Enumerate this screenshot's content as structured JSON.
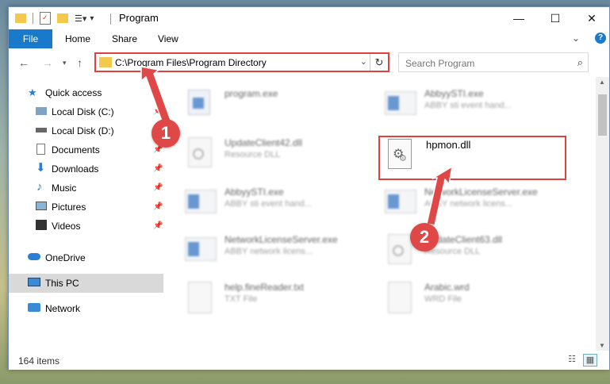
{
  "window": {
    "title": "Program"
  },
  "ribbon": {
    "tabs": [
      {
        "label": "File"
      },
      {
        "label": "Home"
      },
      {
        "label": "Share"
      },
      {
        "label": "View"
      }
    ],
    "expand_icon": "chevron-down-icon",
    "help_label": "?"
  },
  "nav": {
    "address": "C:\\Program Files\\Program Directory",
    "search_placeholder": "Search Program"
  },
  "sidebar": {
    "items": [
      {
        "label": "Quick access"
      },
      {
        "label": "Local Disk (C:)"
      },
      {
        "label": "Local Disk (D:)"
      },
      {
        "label": "Documents"
      },
      {
        "label": "Downloads"
      },
      {
        "label": "Music"
      },
      {
        "label": "Pictures"
      },
      {
        "label": "Videos"
      },
      {
        "label": "OneDrive"
      },
      {
        "label": "This PC"
      },
      {
        "label": "Network"
      }
    ]
  },
  "files": [
    {
      "name": "program.exe",
      "desc": ""
    },
    {
      "name": "AbbyySTI.exe",
      "desc": "ABBY sti event hand..."
    },
    {
      "name": "UpdateClient42.dll",
      "desc": "Resource DLL"
    },
    {
      "name": "hpmon.dll",
      "desc": ""
    },
    {
      "name": "AbbyySTI.exe",
      "desc": "ABBY sti event hand..."
    },
    {
      "name": "NetworkLicenseServer.exe",
      "desc": "ABBY network licens..."
    },
    {
      "name": "NetworkLicenseServer.exe",
      "desc": "ABBY network licens..."
    },
    {
      "name": "UpdateClient63.dll",
      "desc": "Resource DLL"
    },
    {
      "name": "help.fineReader.txt",
      "desc": "TXT File"
    },
    {
      "name": "Arabic.wrd",
      "desc": "WRD File"
    }
  ],
  "status": {
    "items_count": "164 items"
  },
  "annotations": {
    "step1": "1",
    "step2": "2"
  },
  "colors": {
    "accent": "#1979ca",
    "highlight": "#e04040"
  }
}
